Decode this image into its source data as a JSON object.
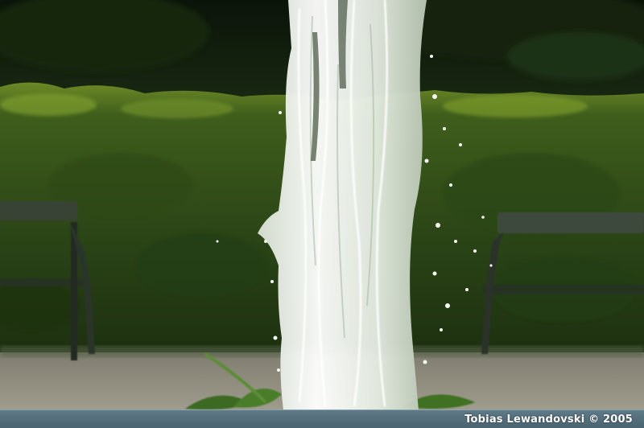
{
  "photo": {
    "subject": "fountain-water-column",
    "colors": {
      "dark_foliage": "#0f1a0c",
      "hedge": "#2f4a18",
      "hedge_highlight": "#7a9a2a",
      "ground": "#9a9686",
      "bench": "#2a3328",
      "water": "#eef2ee"
    },
    "credit": "Tobias Lewandovski © 2005"
  }
}
